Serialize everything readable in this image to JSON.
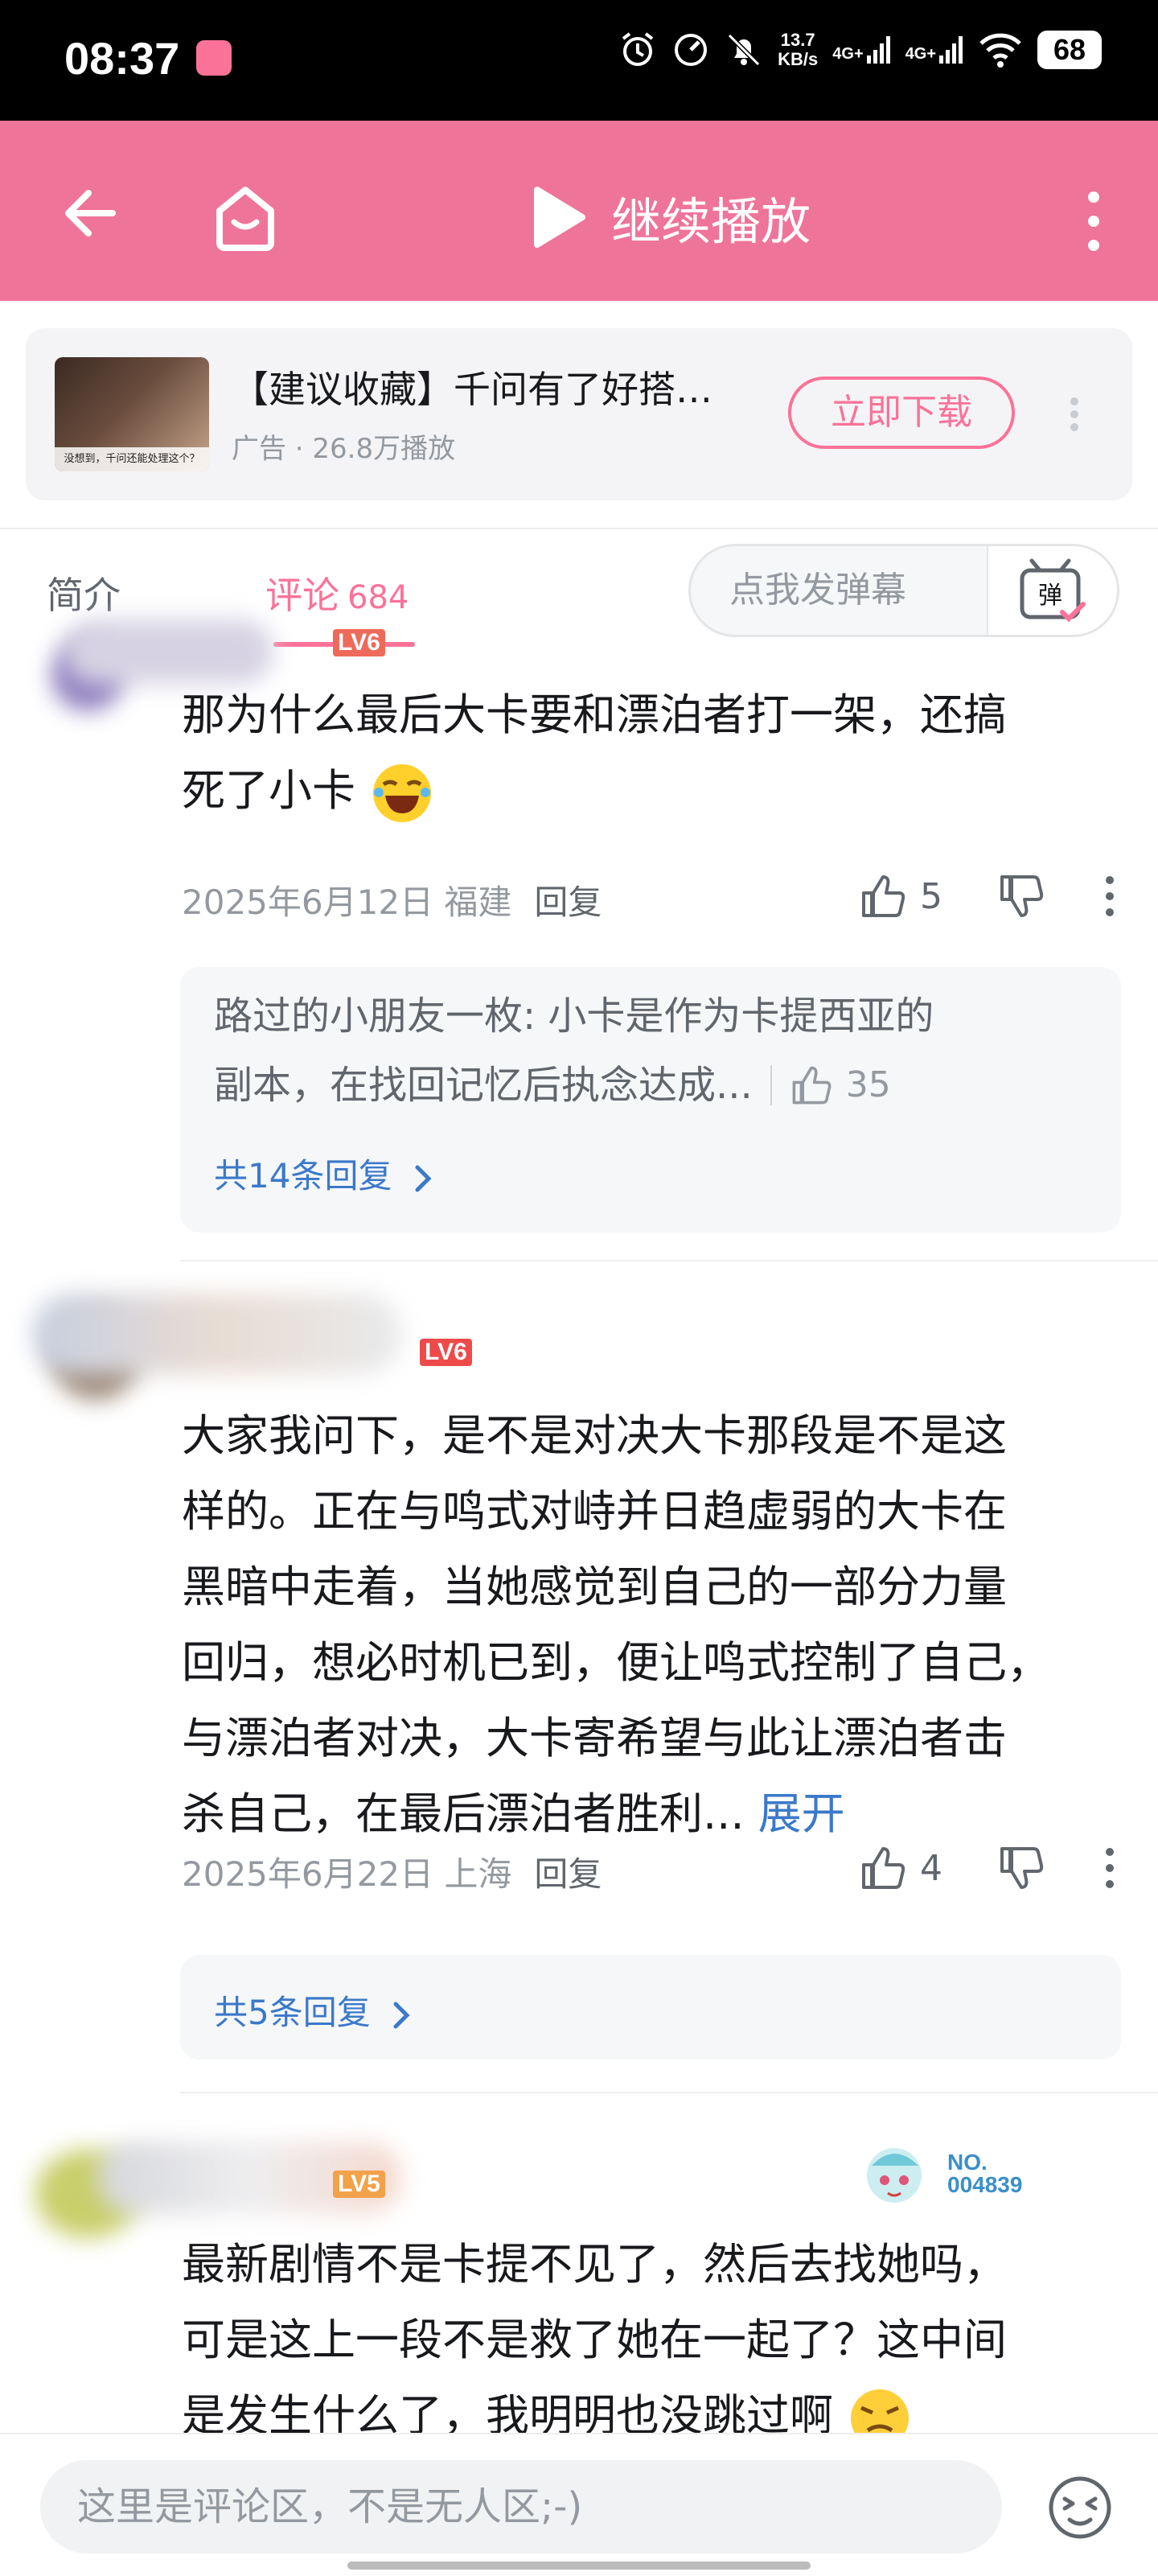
{
  "status_bar": {
    "time": "08:37",
    "net_speed_value": "13.7",
    "net_speed_unit": "KB/s",
    "signal1": "4G+",
    "signal2": "4G+",
    "battery": "68"
  },
  "top_bar": {
    "continue_play": "继续播放"
  },
  "ad": {
    "title": "【建议收藏】千问有了好搭…",
    "meta": "广告 · 26.8万播放",
    "thumb_caption": "没想到，千问还能处理这个？",
    "download_label": "立即下载"
  },
  "tabs": {
    "intro": "简介",
    "comments": "评论",
    "comments_count": "684",
    "danmaku_placeholder": "点我发弹幕",
    "danmaku_toggle": "弹"
  },
  "comments": [
    {
      "level": "LV6",
      "text_line1": "那为什么最后大卡要和漂泊者打一架，还搞",
      "text_line2": "死了小卡",
      "date_location": "2025年6月12日 福建",
      "reply_label": "回复",
      "likes": "5",
      "reply_preview_line1": "路过的小朋友一枚: 小卡是作为卡提西亚的",
      "reply_preview_line2": "副本，在找回记忆后执念达成...",
      "reply_preview_likes": "35",
      "reply_total": "共14条回复"
    },
    {
      "level": "LV6",
      "text_lines": [
        "大家我问下，是不是对决大卡那段是不是这",
        "样的。正在与鸣式对峙并日趋虚弱的大卡在",
        "黑暗中走着，当她感觉到自己的一部分力量",
        "回归，想必时机已到，便让鸣式控制了自己，",
        "与漂泊者对决，大卡寄希望与此让漂泊者击"
      ],
      "text_last": "杀自己，在最后漂泊者胜利...",
      "expand_label": "展开",
      "date_location": "2025年6月22日 上海",
      "reply_label": "回复",
      "likes": "4",
      "reply_total": "共5条回复"
    },
    {
      "level": "LV5",
      "badge_no": "NO.",
      "badge_number": "004839",
      "text_lines": [
        "最新剧情不是卡提不见了，然后去找她吗，",
        "可是这上一段不是救了她在一起了？这中间",
        "是发生什么了，我明明也没跳过啊"
      ]
    }
  ],
  "bottom_bar": {
    "input_placeholder": "这里是评论区，不是无人区;-)"
  },
  "colors": {
    "brand_pink": "#fb7299",
    "top_bar_pink": "#ef7499",
    "link_blue": "#3b79c9",
    "meta_gray": "#9499a0"
  }
}
